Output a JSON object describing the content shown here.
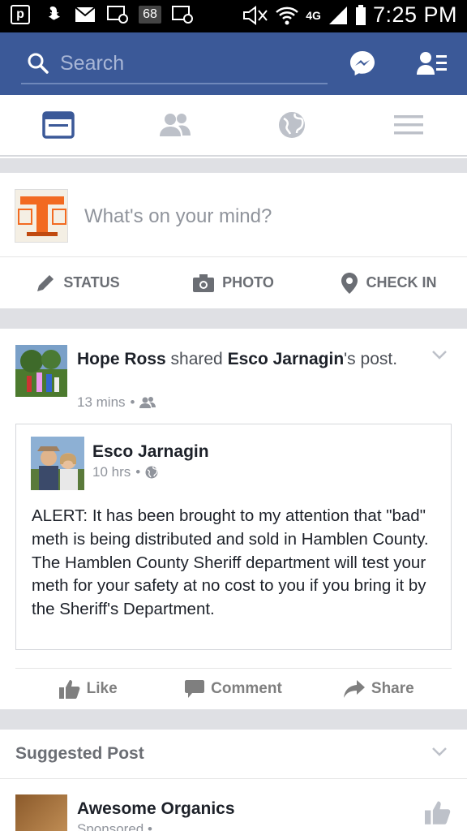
{
  "status_bar": {
    "time": "7:25 PM",
    "temperature": "68",
    "network": "4G",
    "icons": [
      "pinterest-icon",
      "snapchat-icon",
      "mail-icon",
      "voicemail-icon",
      "voicemail-icon",
      "mute-icon",
      "wifi-icon",
      "signal-icon",
      "battery-icon"
    ]
  },
  "header": {
    "search_placeholder": "Search",
    "icons": [
      "search-icon",
      "messenger-icon",
      "friend-requests-icon"
    ],
    "brand_color": "#3b5998"
  },
  "tabs": [
    {
      "name": "news-feed",
      "icon": "news-feed-icon",
      "active": true
    },
    {
      "name": "friends",
      "icon": "friends-icon",
      "active": false
    },
    {
      "name": "notifications",
      "icon": "globe-icon",
      "active": false
    },
    {
      "name": "more",
      "icon": "menu-icon",
      "active": false
    }
  ],
  "composer": {
    "placeholder": "What's on your mind?",
    "actions": {
      "status": "STATUS",
      "photo": "PHOTO",
      "checkin": "CHECK IN"
    }
  },
  "post": {
    "author": "Hope Ross",
    "action_word": "shared",
    "original_author": "Esco Jarnagin",
    "possessive_suffix": "'s",
    "object": "post.",
    "time": "13 mins",
    "dot": "•",
    "shared": {
      "author": "Esco Jarnagin",
      "time": "10 hrs",
      "dot": "•",
      "body": "ALERT:  It has been brought to my attention that \"bad\" meth is being distributed and sold in Hamblen County.  The Hamblen County Sheriff department will test your meth for your safety at no cost to you if you bring it by the Sheriff's Department."
    },
    "actions": {
      "like": "Like",
      "comment": "Comment",
      "share": "Share"
    }
  },
  "suggested": {
    "title": "Suggested Post",
    "page_name": "Awesome Organics",
    "meta": "Sponsored • "
  }
}
